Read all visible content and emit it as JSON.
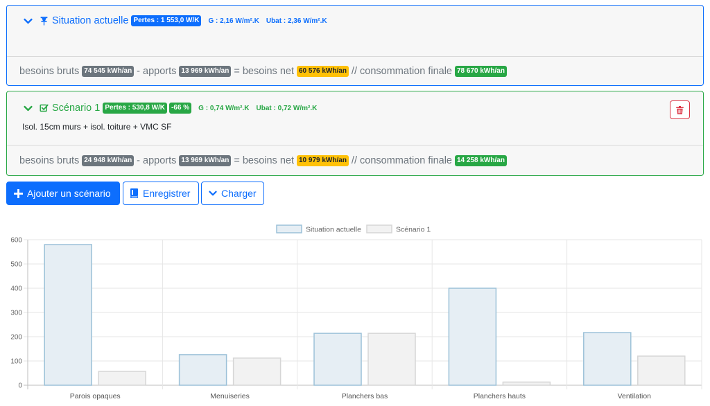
{
  "current": {
    "title": "Situation actuelle",
    "losses": "Pertes : 1 553,0 W/K",
    "g": "G : 2,16 W/m².K",
    "ubat": "Ubat : 2,36 W/m².K",
    "footer": {
      "gross_label": "besoins bruts",
      "gross": "74 545 kWh/an",
      "gains_label": "- apports",
      "gains": "13 969 kWh/an",
      "net_label": "= besoins net",
      "net": "60 576 kWh/an",
      "final_label": "// consommation finale",
      "final": "78 670 kWh/an"
    }
  },
  "scenario1": {
    "title": "Scénario 1",
    "losses": "Pertes : 530,8 W/K",
    "reduction": "-66 %",
    "g": "G : 0,74 W/m².K",
    "ubat": "Ubat : 0,72 W/m².K",
    "description": "Isol. 15cm murs + isol. toiture + VMC SF",
    "footer": {
      "gross_label": "besoins bruts",
      "gross": "24 948 kWh/an",
      "gains_label": "- apports",
      "gains": "13 969 kWh/an",
      "net_label": "= besoins net",
      "net": "10 979 kWh/an",
      "final_label": "// consommation finale",
      "final": "14 258 kWh/an"
    }
  },
  "toolbar": {
    "add_label": "Ajouter un scénario",
    "save_label": "Enregistrer",
    "load_label": "Charger"
  },
  "icons": {
    "current_chevron": "chevron-down-icon",
    "current_pin": "pin-icon",
    "scenario_chevron": "chevron-down-icon",
    "scenario_check": "check-square-icon",
    "delete": "trash-icon",
    "add": "plus-icon",
    "save": "book-icon",
    "load": "chevron-down-icon"
  },
  "colors": {
    "primary": "#0d6efd",
    "success": "#28a745",
    "danger": "#dc3545",
    "warning": "#ffc107",
    "secondary": "#6c757d"
  },
  "chart_data": {
    "type": "bar",
    "categories": [
      "Parois opaques",
      "Menuiseries",
      "Planchers bas",
      "Planchers hauts",
      "Ventilation"
    ],
    "series": [
      {
        "name": "Situation actuelle",
        "values": [
          580,
          126,
          214,
          400,
          217
        ],
        "fill": "#e6eef4",
        "stroke": "#9cc1d8"
      },
      {
        "name": "Scénario 1",
        "values": [
          57,
          112,
          214,
          13,
          120
        ],
        "fill": "#f2f2f2",
        "stroke": "#d6d6d6"
      }
    ],
    "ylim": [
      0,
      600
    ],
    "yticks": [
      0,
      100,
      200,
      300,
      400,
      500,
      600
    ],
    "grid": true,
    "legend": "top-center"
  }
}
